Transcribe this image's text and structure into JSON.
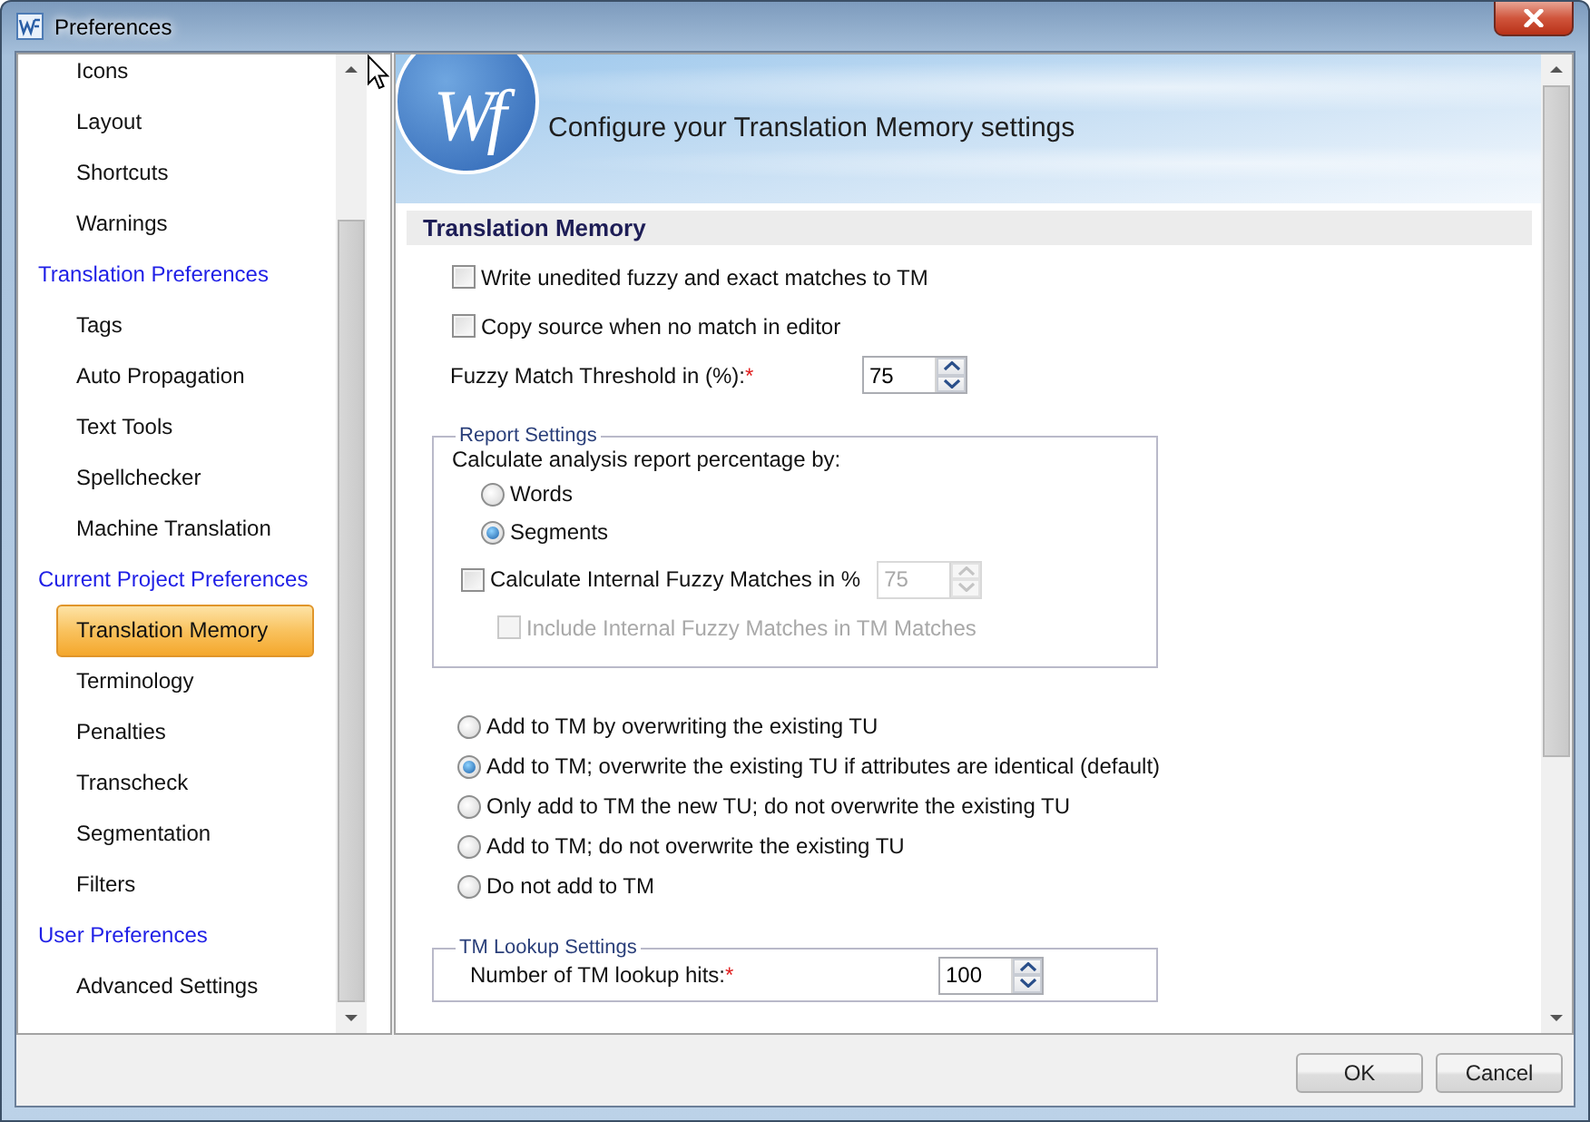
{
  "window": {
    "title": "Preferences"
  },
  "sidebar": {
    "groups": [
      {
        "children": [
          {
            "label": "Icons",
            "selected": false
          },
          {
            "label": "Layout",
            "selected": false
          },
          {
            "label": "Shortcuts",
            "selected": false
          },
          {
            "label": "Warnings",
            "selected": false
          }
        ]
      },
      {
        "label": "Translation Preferences",
        "children": [
          {
            "label": "Tags",
            "selected": false
          },
          {
            "label": "Auto Propagation",
            "selected": false
          },
          {
            "label": "Text Tools",
            "selected": false
          },
          {
            "label": "Spellchecker",
            "selected": false
          },
          {
            "label": "Machine Translation",
            "selected": false
          }
        ]
      },
      {
        "label": "Current Project Preferences",
        "children": [
          {
            "label": "Translation Memory",
            "selected": true
          },
          {
            "label": "Terminology",
            "selected": false
          },
          {
            "label": "Penalties",
            "selected": false
          },
          {
            "label": "Transcheck",
            "selected": false
          },
          {
            "label": "Segmentation",
            "selected": false
          },
          {
            "label": "Filters",
            "selected": false
          }
        ]
      },
      {
        "label": "User Preferences",
        "children": [
          {
            "label": "Advanced Settings",
            "selected": false
          }
        ]
      }
    ]
  },
  "header": {
    "logo": "Wf",
    "title": "Configure your Translation Memory settings"
  },
  "section": {
    "title": "Translation Memory"
  },
  "options": [
    {
      "label": "Write unedited fuzzy and exact matches to TM",
      "checked": false
    },
    {
      "label": "Copy source when no match in editor",
      "checked": false
    }
  ],
  "threshold": {
    "label": "Fuzzy Match Threshold in (%):",
    "required_mark": "*",
    "value": "75"
  },
  "report_settings": {
    "legend": "Report Settings",
    "prompt": "Calculate analysis report percentage by:",
    "basis": [
      {
        "label": "Words",
        "selected": false
      },
      {
        "label": "Segments",
        "selected": true
      }
    ],
    "internal": {
      "label": "Calculate Internal Fuzzy Matches in %",
      "checked": false,
      "value": "75",
      "value_disabled": true
    },
    "include": {
      "label": "Include Internal Fuzzy Matches in TM Matches",
      "checked": false,
      "disabled": true
    }
  },
  "write_mode": [
    {
      "label": "Add to TM by overwriting the existing TU",
      "selected": false
    },
    {
      "label": "Add to TM; overwrite the existing TU if attributes are identical (default)",
      "selected": true
    },
    {
      "label": "Only add to TM the new TU; do not overwrite the existing TU",
      "selected": false
    },
    {
      "label": "Add to TM; do not overwrite the existing TU",
      "selected": false
    },
    {
      "label": "Do not add to TM",
      "selected": false
    }
  ],
  "lookup": {
    "legend": "TM Lookup Settings",
    "label": "Number of TM lookup hits:",
    "required_mark": "*",
    "value": "100"
  },
  "buttons": [
    {
      "label": "OK"
    },
    {
      "label": "Cancel"
    }
  ]
}
